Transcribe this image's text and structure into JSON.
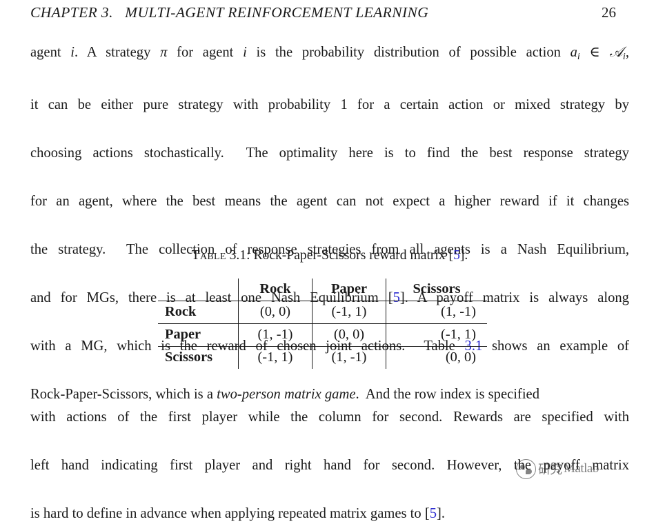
{
  "header": {
    "chapter_title": "CHAPTER 3.   MULTI-AGENT REINFORCEMENT LEARNING",
    "page_number": "26"
  },
  "paragraph_top": {
    "lines": [
      {
        "segments": [
          {
            "text": "agent ",
            "style": "normal"
          },
          {
            "text": "i",
            "style": "math-italic"
          },
          {
            "text": ". A strategy ",
            "style": "normal"
          },
          {
            "text": "π",
            "style": "math-italic"
          },
          {
            "text": " for agent ",
            "style": "normal"
          },
          {
            "text": "i",
            "style": "math-italic"
          },
          {
            "text": " is the probability distribution of possible action ",
            "style": "normal"
          },
          {
            "text": "a",
            "style": "math-italic"
          },
          {
            "text": "i",
            "style": "subscript"
          },
          {
            "text": " ∈ ",
            "style": "normal"
          },
          {
            "text": "𝒜",
            "style": "calligraphic"
          },
          {
            "text": "i",
            "style": "subscript"
          },
          {
            "text": ",",
            "style": "normal"
          }
        ]
      },
      {
        "segments": [
          {
            "text": "it can be either pure strategy with probability 1 for a certain action or mixed strategy by",
            "style": "normal"
          }
        ]
      },
      {
        "segments": [
          {
            "text": "choosing actions stochastically.  The optimality here is to find the best response strategy",
            "style": "normal"
          }
        ]
      },
      {
        "segments": [
          {
            "text": "for an agent, where the best means the agent can not expect a higher reward if it changes",
            "style": "normal"
          }
        ]
      },
      {
        "segments": [
          {
            "text": "the strategy.  The collection of response strategies from all agents is a Nash Equilibrium,",
            "style": "normal"
          }
        ]
      },
      {
        "segments": [
          {
            "text": "and for MGs, there is at least one Nash Equilibrium [",
            "style": "normal"
          },
          {
            "text": "5",
            "style": "link"
          },
          {
            "text": "]. A payoff matrix is always along",
            "style": "normal"
          }
        ]
      },
      {
        "segments": [
          {
            "text": "with a MG, which is the reward of chosen joint actions.  Table ",
            "style": "normal"
          },
          {
            "text": "3.1",
            "style": "link"
          },
          {
            "text": " shows an example of",
            "style": "normal"
          }
        ]
      },
      {
        "segments": [
          {
            "text": "Rock-Paper-Scissors, which is a ",
            "style": "normal"
          },
          {
            "text": "two-person matrix game",
            "style": "italic"
          },
          {
            "text": ".  And the row index is specified",
            "style": "normal"
          }
        ]
      }
    ]
  },
  "table_caption": {
    "label": "Table",
    "number": "3.1",
    "separator": ": ",
    "text": "Rock-Paper-Scissors reward matrix [",
    "citation": "5",
    "text_end": "]."
  },
  "payoff_table": {
    "corner_label": "",
    "column_headers": [
      "Rock",
      "Paper",
      "Scissors"
    ],
    "rows": [
      {
        "header": "Rock",
        "cells": [
          "(0, 0)",
          "(-1, 1)",
          "(1, -1)"
        ]
      },
      {
        "header": "Paper",
        "cells": [
          "(1, -1)",
          "(0, 0)",
          "(-1, 1)"
        ]
      },
      {
        "header": "Scissors",
        "cells": [
          "(-1, 1)",
          "(1, -1)",
          "(0, 0)"
        ]
      }
    ]
  },
  "paragraph_bottom": {
    "lines": [
      {
        "segments": [
          {
            "text": "with actions of the first player while the column for second. Rewards are specified with",
            "style": "normal"
          }
        ]
      },
      {
        "segments": [
          {
            "text": "left hand indicating first player and right hand for second. However, the payoff matrix",
            "style": "normal"
          }
        ]
      },
      {
        "segments": [
          {
            "text": "is hard to define in advance when applying repeated matrix games to [",
            "style": "normal"
          },
          {
            "text": "5",
            "style": "link"
          },
          {
            "text": "].",
            "style": "normal"
          }
        ]
      }
    ]
  },
  "watermark": {
    "chinese_text": "研究",
    "english_text": "Matlab",
    "logo": "circular-mark"
  },
  "colors": {
    "text": "#1a1a1a",
    "link": "#2a2ad0",
    "rule": "#1a1a1a",
    "background": "#ffffff"
  }
}
